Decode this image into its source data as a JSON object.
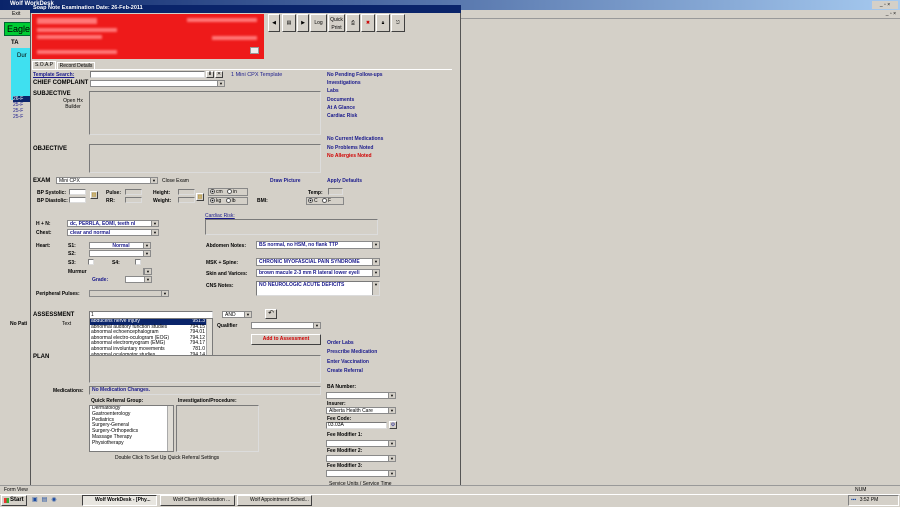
{
  "bg_window": {
    "title": "Wolf WorkDesk",
    "menu": "Exit",
    "clinic": "Eagle",
    "side_letters": [
      "TA",
      "Dur"
    ],
    "sched_items": [
      "26-F",
      "25-F",
      "25-F",
      "25-F"
    ],
    "no_patient": "No Pati"
  },
  "title": "Soap Note Examination Date: 26-Feb-2011",
  "toolbar": {
    "log": "Log",
    "quick_print": "Quick Print"
  },
  "tabs": [
    "S.O.A.P",
    "Record Details"
  ],
  "template": {
    "label": "Template Search:",
    "result": "1 Mini CPX Template"
  },
  "chief_complaint": "CHIEF COMPLAINT",
  "subjective": {
    "title": "SUBJECTIVE",
    "builder": "Open Hx Builder"
  },
  "objective": "OBJECTIVE",
  "exam": {
    "label": "EXAM",
    "value": "Mini CPX",
    "close": "Close Exam"
  },
  "vitals": {
    "bp_sys": "BP Systolic:",
    "bp_dia": "BP Diastolic:",
    "pulse": "Pulse:",
    "rr": "RR:",
    "height": "Height:",
    "weight": "Weight:",
    "cm": "cm",
    "in": "in",
    "kg": "kg",
    "lb": "lb",
    "bmi": "BMI:",
    "temp": "Temp:",
    "c": "C",
    "f": "F"
  },
  "draw_picture": "Draw Picture",
  "apply_defaults": "Apply Defaults",
  "cardiac_risk": "Cardiac Risk:",
  "hnn": {
    "label": "H + N:",
    "value": "dc, PERRLA, EOMI, teeth nl"
  },
  "chest": {
    "label": "Chest:",
    "value": "clear and normal"
  },
  "heart": {
    "label": "Heart:",
    "s1": "S1:",
    "s1_value": "Normal",
    "s2": "S2:",
    "s3": "S3:",
    "s4": "S4:",
    "murmur": "Murmur",
    "grade": "Grade:"
  },
  "abdomen": {
    "label": "Abdomen Notes:",
    "value": "BS normal, no HSM, no flank TTP"
  },
  "msk": {
    "label": "MSK + Spine:",
    "value": "CHRONIC MYOFASCIAL PAIN SYNDROME"
  },
  "skin": {
    "label": "Skin and Varices:",
    "value": "brown macule 2-3 mm R lateral lower eyeli"
  },
  "cns": {
    "label": "CNS Notes:",
    "value": "NO NEUROLOGIC ACUTE DEFICITS"
  },
  "peripheral": "Peripheral Pulses:",
  "assessment": {
    "title": "ASSESSMENT",
    "text_label": "Text",
    "input": "1",
    "and": "AND",
    "qualifier": "Qualifier",
    "add_btn": "Add to Assessment"
  },
  "dx_list": [
    {
      "name": "abducens nerve injury",
      "code": "951.3"
    },
    {
      "name": "abnormal auditory function studies",
      "code": "794.15"
    },
    {
      "name": "abnormal echoencephalogram",
      "code": "794.01"
    },
    {
      "name": "abnormal electro-oculogram (EOG)",
      "code": "794.12"
    },
    {
      "name": "abnormal electromyogram (EMG)",
      "code": "794.17"
    },
    {
      "name": "abnormal involuntary movements",
      "code": "781.0"
    },
    {
      "name": "abnormal oculomotor studies",
      "code": "794.14"
    }
  ],
  "plan": "PLAN",
  "medications": {
    "label": "Medications:",
    "value": "No Medication Changes."
  },
  "referral": {
    "group_label": "Quick Referral Group:",
    "inv_label": "Investigation/Procedure:",
    "items": [
      "Dermatology",
      "Gastroenterology",
      "Pediatrics",
      "Surgery-General",
      "Surgery-Orthopedics",
      "Massage Therapy",
      "Physiotherapy"
    ],
    "hint": "Double Click To Set Up Quick Referral Settings"
  },
  "right_links_top": [
    "No Pending Follow-ups",
    "Investigations",
    "Labs",
    "Documents",
    "At A Glance",
    "Cardiac Risk"
  ],
  "right_links_mid": [
    "No Current Medications",
    "No Problems Noted"
  ],
  "allergy": "No Allergies Noted",
  "orders": [
    "Order Labs",
    "Prescribe Medication",
    "Enter Vaccination",
    "Create Referral"
  ],
  "billing": {
    "ba": "BA Number:",
    "insurer": "Insurer:",
    "insurer_value": "Alberta Health Care",
    "fee_code": "Fee Code:",
    "fee_value": "03.03A",
    "mod1": "Fee Modifier 1:",
    "mod2": "Fee Modifier 2:",
    "mod3": "Fee Modifier 3:",
    "service": "Service Units / Service Time"
  },
  "statusbar": {
    "left": "Form View",
    "num": "NUM"
  },
  "taskbar": {
    "start": "Start",
    "items": [
      "Wolf WorkDesk - [Phy...",
      "Wolf Client Workstation ...",
      "Wolf Appointment Sched..."
    ],
    "clock": "3:52 PM"
  }
}
